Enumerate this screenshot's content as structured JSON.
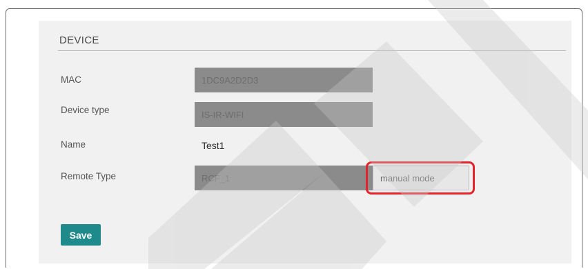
{
  "section": {
    "title": "DEVICE"
  },
  "fields": {
    "mac_label": "MAC",
    "mac_value": "1DC9A2D2D3",
    "device_type_label": "Device type",
    "device_type_value": "IS-IR-WIFI",
    "name_label": "Name",
    "name_value": "Test1",
    "remote_type_label": "Remote Type",
    "remote_type_value": "RCF_1",
    "mode_value": "manual mode"
  },
  "actions": {
    "save_label": "Save"
  },
  "colors": {
    "save_button": "#1f8a8c",
    "highlight": "#e4242a",
    "panel": "#f1f1f1"
  }
}
